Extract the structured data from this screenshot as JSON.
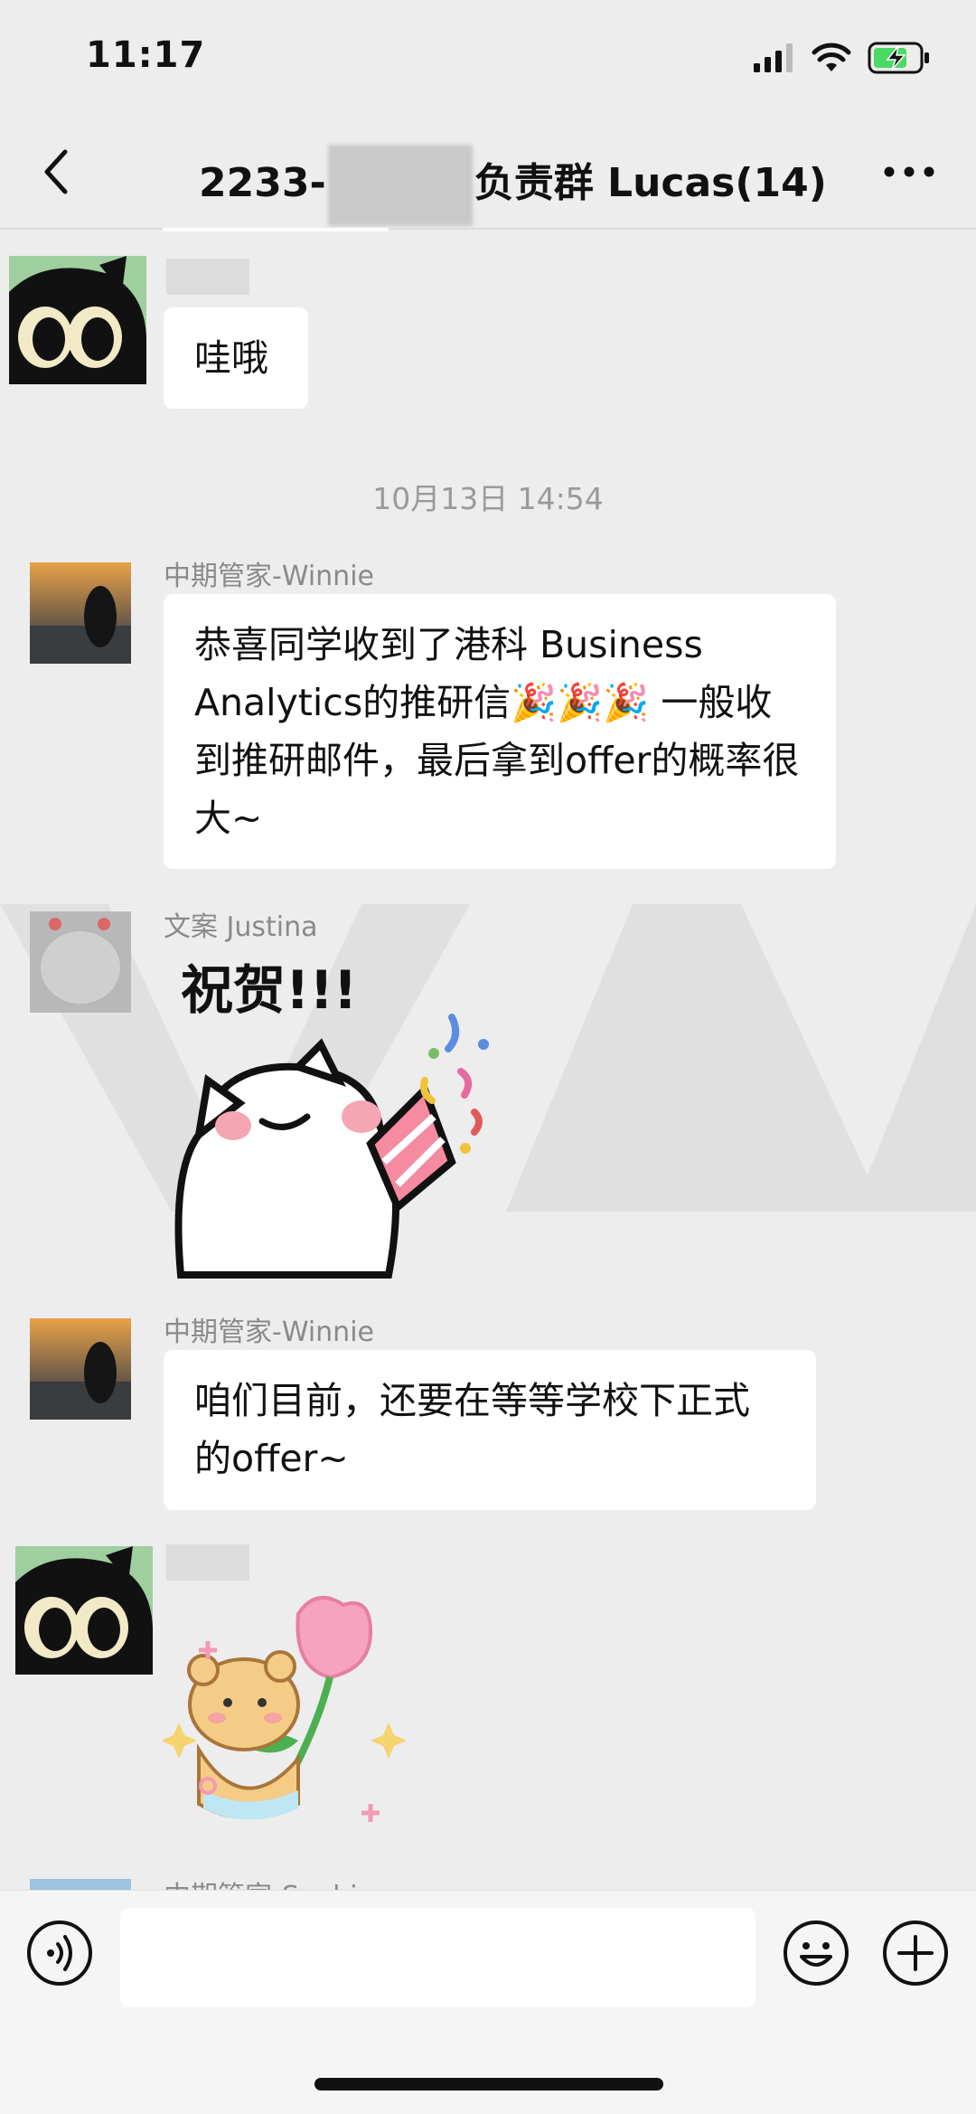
{
  "status_bar": {
    "time": "11:17"
  },
  "nav": {
    "title_prefix": "2233-",
    "title_suffix": "负责群 Lucas(14)"
  },
  "messages": [
    {
      "text": "哇哦"
    },
    {
      "timestamp": "10月13日 14:54"
    },
    {
      "sender": "中期管家-Winnie",
      "text": "恭喜同学收到了港科 Business Analytics的推研信🎉🎉🎉 一般收到推研邮件，最后拿到offer的概率很大~"
    },
    {
      "sender": "文案 Justina",
      "sticker_caption": "祝贺!!!"
    },
    {
      "sender": "中期管家-Winnie",
      "text": "咱们目前，还要在等等学校下正式的offer~"
    },
    {
      "sticker": "bear-with-tulip"
    },
    {
      "sender": "中期管家-Sophie"
    }
  ],
  "icons": {
    "back": "chevron-left-icon",
    "more": "more-dots-icon",
    "voice": "voice-icon",
    "emoji": "emoji-icon",
    "plus": "plus-icon"
  },
  "colors": {
    "background": "#ededed",
    "bubble": "#ffffff",
    "accent_green": "#4cd964"
  }
}
